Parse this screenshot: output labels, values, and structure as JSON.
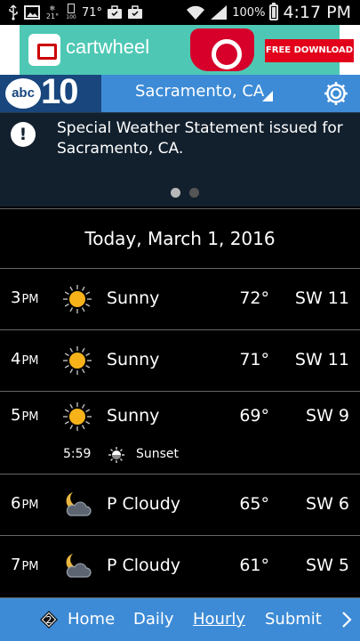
{
  "status_bar": {
    "badge_21": "21°",
    "badge_100": "100",
    "temp": "71°",
    "battery_pct": "100%",
    "time": "4:17 PM"
  },
  "ad": {
    "brand": "cartwheel",
    "cta": "FREE DOWNLOAD"
  },
  "header": {
    "logo_abc": "abc",
    "logo_num": "10",
    "city": "Sacramento, CA"
  },
  "alert": {
    "text": "Special Weather Statement issued for Sacramento, CA.",
    "page_count": 2,
    "active_page": 1
  },
  "date": "Today, March 1, 2016",
  "hours": [
    {
      "hour": "3",
      "ampm": "PM",
      "icon": "sun-icon",
      "condition": "Sunny",
      "temp": "72°",
      "wind": "SW 11"
    },
    {
      "hour": "4",
      "ampm": "PM",
      "icon": "sun-icon",
      "condition": "Sunny",
      "temp": "71°",
      "wind": "SW 11"
    },
    {
      "hour": "5",
      "ampm": "PM",
      "icon": "sun-icon",
      "condition": "Sunny",
      "temp": "69°",
      "wind": "SW 9",
      "sunset_time": "5:59",
      "sunset_label": "Sunset"
    },
    {
      "hour": "6",
      "ampm": "PM",
      "icon": "moon-cloud-icon",
      "condition": "P Cloudy",
      "temp": "65°",
      "wind": "SW 6"
    },
    {
      "hour": "7",
      "ampm": "PM",
      "icon": "moon-cloud-icon",
      "condition": "P Cloudy",
      "temp": "61°",
      "wind": "SW 5"
    }
  ],
  "nav": {
    "badge": "2",
    "home": "Home",
    "daily": "Daily",
    "hourly": "Hourly",
    "submit": "Submit",
    "active": "Hourly"
  },
  "colors": {
    "header_blue": "#3d8bd6",
    "logo_navy": "#18467d",
    "alert_bg": "#12202e",
    "sun_yellow": "#f7b21a",
    "ad_teal": "#4ec8b4",
    "ad_red": "#e2001a"
  }
}
